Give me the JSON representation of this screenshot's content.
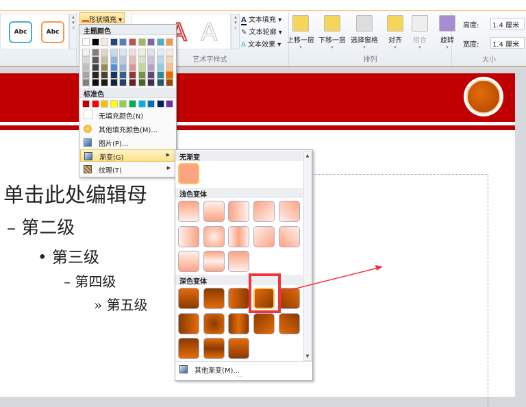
{
  "ribbon": {
    "shape_styles": [
      "Abc",
      "Abc"
    ],
    "shape_fill_label": "形状填充",
    "wordart_group_label": "艺术字样式",
    "text_fill": "文本填充",
    "text_outline": "文本轮廓",
    "text_effects": "文本效果",
    "arrange_group_label": "排列",
    "arrange_buttons": [
      "上移一层",
      "下移一层",
      "选择窗格",
      "对齐",
      "组合",
      "旋转"
    ],
    "size_group_label": "大小",
    "height_label": "高度:",
    "height_value": "1.4 厘米",
    "width_label": "宽度:",
    "width_value": "1.4 厘米"
  },
  "slide": {
    "levels": [
      "单击此处编辑母",
      "第二级",
      "第三级",
      "第四级",
      "第五级"
    ],
    "bullets": [
      "–",
      "•",
      "–",
      "»"
    ]
  },
  "fill_menu": {
    "theme_colors_label": "主题颜色",
    "theme_colors": [
      "#ffffff",
      "#000000",
      "#eeece1",
      "#1f497d",
      "#4f81bd",
      "#c0504d",
      "#9bbb59",
      "#8064a2",
      "#4bacc6",
      "#f79646"
    ],
    "theme_shades": [
      [
        "#f2f2f2",
        "#d9d9d9",
        "#bfbfbf",
        "#a6a6a6",
        "#808080"
      ],
      [
        "#808080",
        "#595959",
        "#404040",
        "#262626",
        "#0d0d0d"
      ],
      [
        "#ddd9c4",
        "#c4bd97",
        "#948a54",
        "#4a452a",
        "#1d1b11"
      ],
      [
        "#c6d9f1",
        "#8db3e2",
        "#548dd4",
        "#17365d",
        "#0f243e"
      ],
      [
        "#dce6f2",
        "#b9cde5",
        "#95b3d7",
        "#366092",
        "#244062"
      ],
      [
        "#f2dcdb",
        "#e6b9b8",
        "#da9694",
        "#963634",
        "#632523"
      ],
      [
        "#ebf1de",
        "#d7e4bd",
        "#c4d79b",
        "#76933c",
        "#4f6228"
      ],
      [
        "#e4dfec",
        "#ccc0da",
        "#b1a0c7",
        "#60497a",
        "#403151"
      ],
      [
        "#dbeef4",
        "#b7dee8",
        "#92cddc",
        "#31869b",
        "#215967"
      ],
      [
        "#fde9d9",
        "#fcd5b4",
        "#fabf8f",
        "#e26b0a",
        "#974706"
      ]
    ],
    "standard_colors_label": "标准色",
    "standard_colors": [
      "#c00000",
      "#ff0000",
      "#ffc000",
      "#ffff00",
      "#92d050",
      "#00b050",
      "#00b0f0",
      "#0070c0",
      "#002060",
      "#7030a0"
    ],
    "items": [
      "无填充颜色(N)",
      "其他填充颜色(M)...",
      "图片(P)...",
      "渐变(G)",
      "纹理(T)"
    ]
  },
  "gradient_menu": {
    "no_gradient_label": "无渐变",
    "light_label": "浅色变体",
    "dark_label": "深色变体",
    "more_label": "其他渐变(M)...",
    "light_color": "#fda384",
    "dark_color": "#e36c0a",
    "selected_dark_index": 3
  }
}
